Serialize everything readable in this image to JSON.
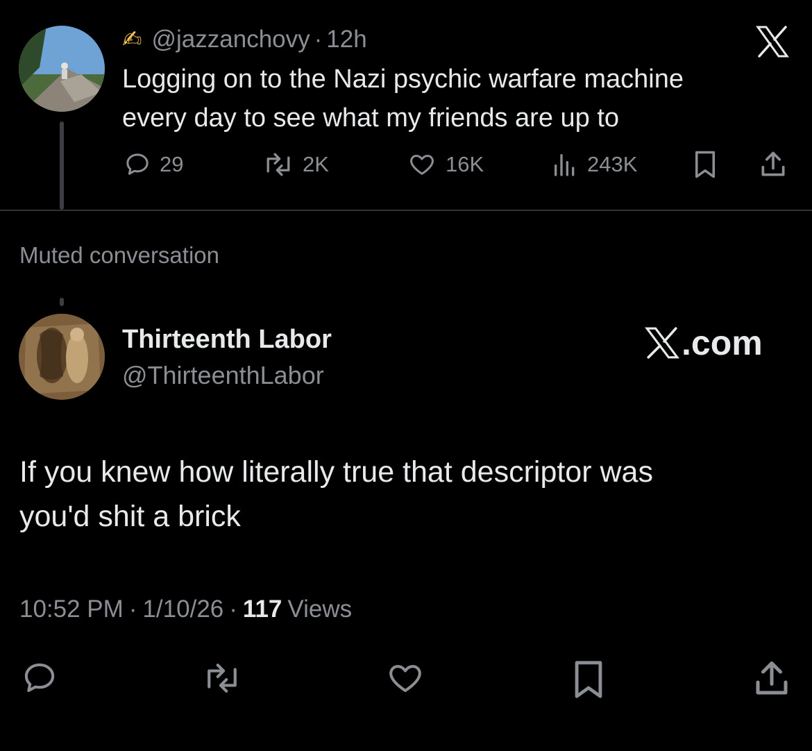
{
  "quoted": {
    "emoji": "✍",
    "handle": "@jazzanchovy",
    "sep": "·",
    "time": "12h",
    "text_line1": "Logging on to the Nazi psychic warfare machine",
    "text_line2": "every day to see what my friends are up to",
    "stats": {
      "replies": "29",
      "reposts": "2K",
      "likes": "16K",
      "views": "243K"
    }
  },
  "muted_label": "Muted conversation",
  "post": {
    "display_name": "Thirteenth Labor",
    "handle": "@ThirteenthLabor",
    "x_logo_text": ".com",
    "text_line1": "If you knew how literally true that descriptor was",
    "text_line2": "you'd shit a brick",
    "meta": {
      "time": "10:52 PM",
      "sep": "·",
      "date": "1/10/26",
      "views_count": "117",
      "views_label": "Views"
    }
  },
  "colors": {
    "background": "#000000",
    "text": "#e7e9ea",
    "secondary": "#8b8f94",
    "divider": "#2f3336"
  }
}
